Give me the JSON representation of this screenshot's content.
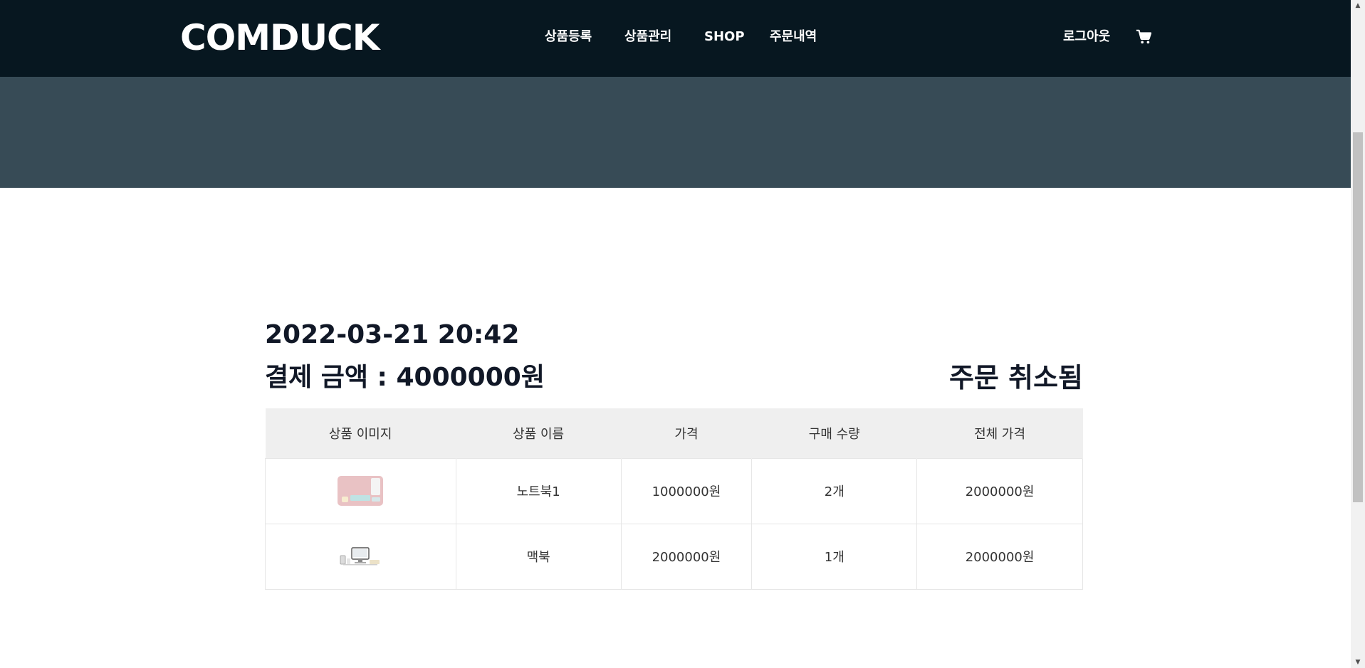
{
  "header": {
    "logo": "COMDUCK",
    "nav": [
      {
        "label": "상품등록"
      },
      {
        "label": "상품관리"
      },
      {
        "label": "SHOP"
      },
      {
        "label": "주문내역"
      }
    ],
    "logout_label": "로그아웃",
    "cart_icon": "shopping-cart-icon"
  },
  "order": {
    "date": "2022-03-21 20:42",
    "total_label": "결제 금액 : 4000000원",
    "status": "주문 취소됨",
    "columns": [
      "상품 이미지",
      "상품 이름",
      "가격",
      "구매 수량",
      "전체 가격"
    ],
    "rows": [
      {
        "image": "laptop-thumbnail",
        "name": "노트북1",
        "price": "1000000원",
        "quantity": "2개",
        "total": "2000000원"
      },
      {
        "image": "macbook-thumbnail",
        "name": "맥북",
        "price": "2000000원",
        "quantity": "1개",
        "total": "2000000원"
      }
    ]
  },
  "colors": {
    "nav_bg": "#071720",
    "hero_bg": "#374b56",
    "table_header_bg": "#efefef"
  }
}
